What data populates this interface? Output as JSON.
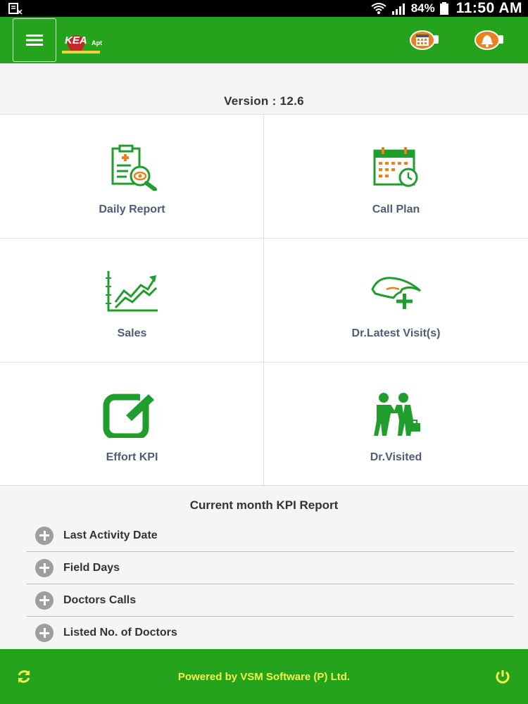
{
  "status_bar": {
    "battery": "84%",
    "time": "11:50 AM"
  },
  "app_bar": {
    "logo_text": "KEA",
    "logo_sub": "Apt"
  },
  "version": "Version : 12.6",
  "tiles": [
    {
      "label": "Daily Report"
    },
    {
      "label": "Call Plan"
    },
    {
      "label": "Sales"
    },
    {
      "label": "Dr.Latest Visit(s)"
    },
    {
      "label": "Effort KPI"
    },
    {
      "label": "Dr.Visited"
    }
  ],
  "kpi": {
    "title": "Current month KPI Report",
    "items": [
      {
        "label": "Last Activity Date"
      },
      {
        "label": "Field Days"
      },
      {
        "label": "Doctors Calls"
      },
      {
        "label": "Listed No. of Doctors"
      }
    ]
  },
  "footer": {
    "text": "Powered by VSM Software (P) Ltd."
  },
  "colors": {
    "primary": "#25a31d",
    "footer_text": "#f4f14a",
    "label": "#4e5c78",
    "icon_orange": "#e8821e"
  }
}
